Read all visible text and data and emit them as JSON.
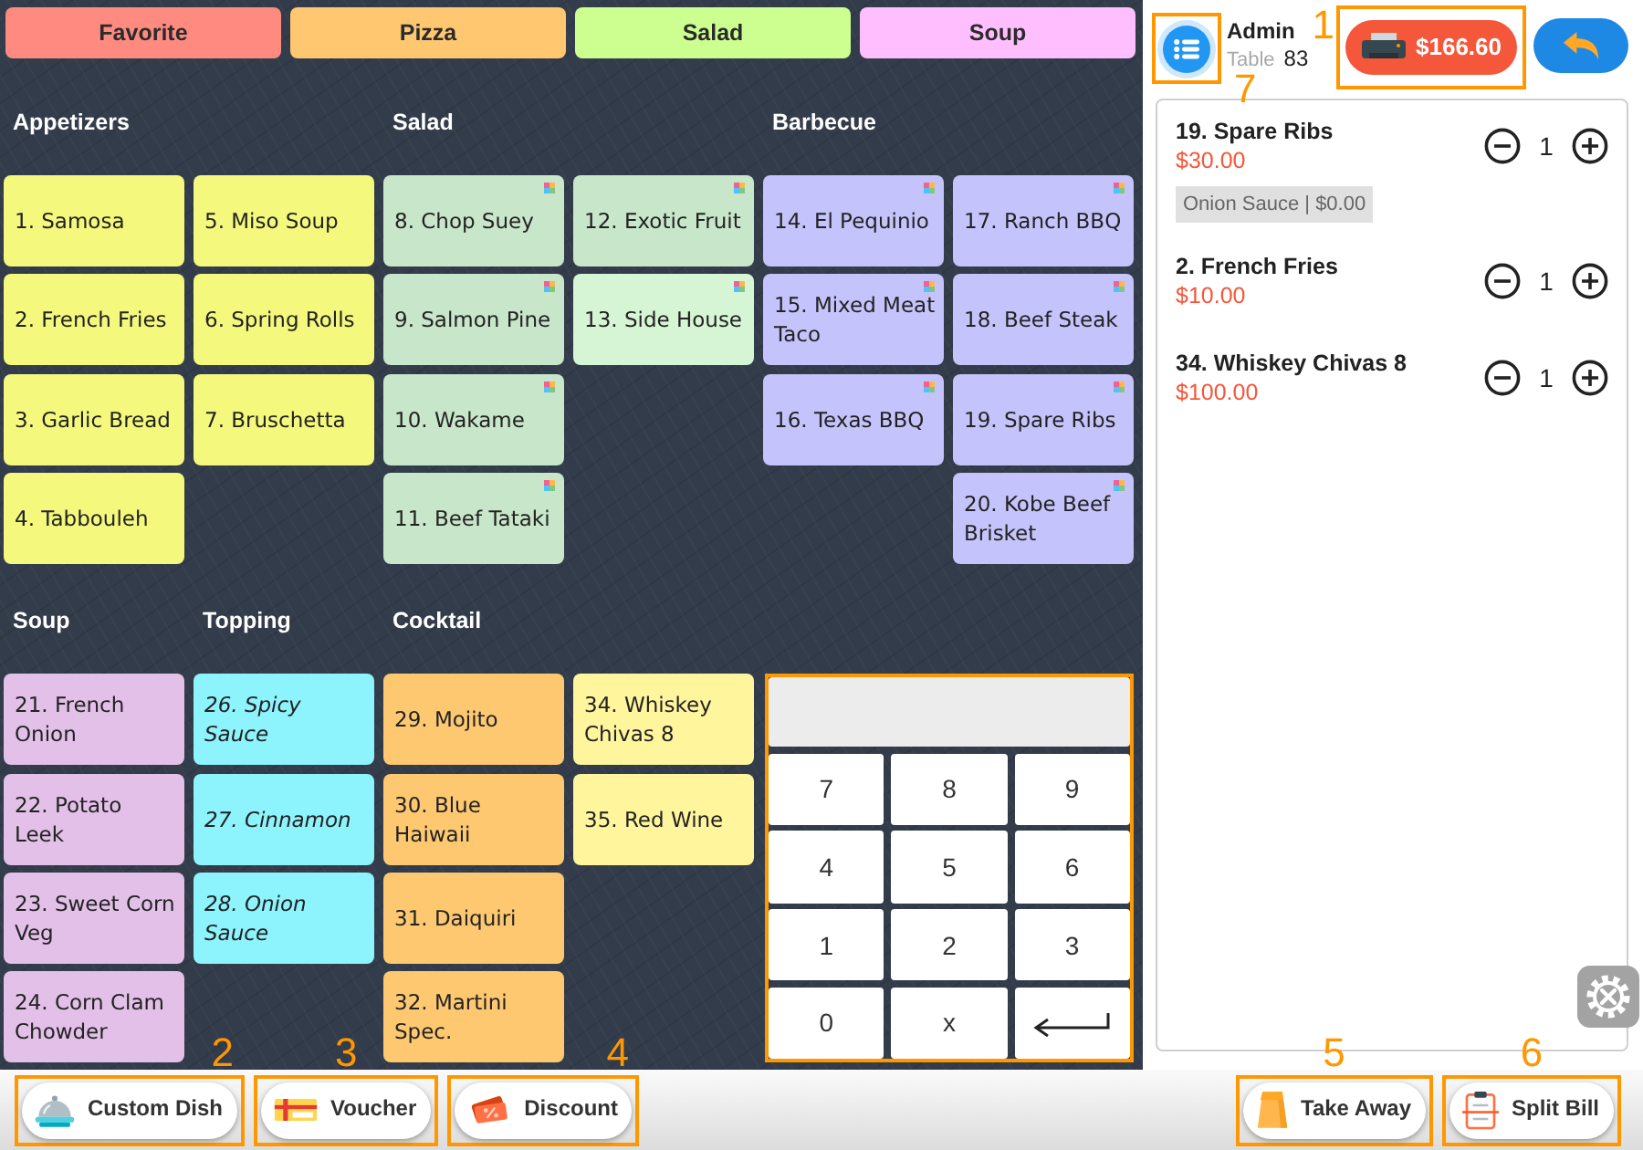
{
  "categories": [
    {
      "label": "Favorite",
      "color": "#ff8a80"
    },
    {
      "label": "Pizza",
      "color": "#ffc870"
    },
    {
      "label": "Salad",
      "color": "#ccff90"
    },
    {
      "label": "Soup",
      "color": "#ffbfff"
    }
  ],
  "menu_rows": [
    {
      "sections": [
        {
          "title": "Appetizers",
          "kind": "dish",
          "columns": [
            [
              {
                "name": "1. Samosa",
                "color": "#f4f87c",
                "modifier_icon": false
              },
              {
                "name": "2. French Fries",
                "color": "#f4f87c",
                "modifier_icon": false
              },
              {
                "name": "3. Garlic Bread",
                "color": "#f4f87c",
                "modifier_icon": false
              },
              {
                "name": "4. Tabbouleh",
                "color": "#f4f87c",
                "modifier_icon": false
              }
            ],
            [
              {
                "name": "5. Miso Soup",
                "color": "#f4f87c",
                "modifier_icon": false
              },
              {
                "name": "6. Spring Rolls",
                "color": "#f4f87c",
                "modifier_icon": false
              },
              {
                "name": "7. Bruschetta",
                "color": "#f4f87c",
                "modifier_icon": false
              }
            ]
          ]
        },
        {
          "title": "Salad",
          "kind": "dish",
          "columns": [
            [
              {
                "name": "8. Chop Suey",
                "color": "#c8e6c9",
                "modifier_icon": true
              },
              {
                "name": "9. Salmon Pine",
                "color": "#c8e6c9",
                "modifier_icon": true
              },
              {
                "name": "10. Wakame",
                "color": "#c8e6c9",
                "modifier_icon": true
              },
              {
                "name": "11. Beef Tataki",
                "color": "#c8e6c9",
                "modifier_icon": true
              }
            ],
            [
              {
                "name": "12. Exotic Fruit",
                "color": "#c8e6c9",
                "modifier_icon": true
              },
              {
                "name": "13. Side House",
                "color": "#d6f5d4",
                "modifier_icon": true
              }
            ]
          ]
        },
        {
          "title": "Barbecue",
          "kind": "dish",
          "columns": [
            [
              {
                "name": "14. El Pequinio",
                "color": "#c5c3fb",
                "modifier_icon": true
              },
              {
                "name": "15. Mixed Meat Taco",
                "color": "#c5c3fb",
                "modifier_icon": true
              },
              {
                "name": "16. Texas BBQ",
                "color": "#c5c3fb",
                "modifier_icon": true
              }
            ],
            [
              {
                "name": "17. Ranch BBQ",
                "color": "#c5c3fb",
                "modifier_icon": true
              },
              {
                "name": "18. Beef Steak",
                "color": "#c5c3fb",
                "modifier_icon": true
              },
              {
                "name": "19. Spare Ribs",
                "color": "#c5c3fb",
                "modifier_icon": true
              },
              {
                "name": "20. Kobe Beef Brisket",
                "color": "#c5c3fb",
                "modifier_icon": true
              }
            ]
          ]
        }
      ]
    },
    {
      "sections": [
        {
          "title": "Soup",
          "kind": "dish",
          "columns": [
            [
              {
                "name": "21. French Onion",
                "color": "#e2c0e8",
                "modifier_icon": false
              },
              {
                "name": "22. Potato Leek",
                "color": "#e2c0e8",
                "modifier_icon": false
              },
              {
                "name": "23. Sweet Corn Veg",
                "color": "#e2c0e8",
                "modifier_icon": false
              },
              {
                "name": "24. Corn Clam Chowder",
                "color": "#e2c0e8",
                "modifier_icon": false
              }
            ]
          ]
        },
        {
          "title": "Topping",
          "kind": "topping",
          "columns": [
            [
              {
                "name": "26. Spicy Sauce",
                "color": "#8df3fc",
                "modifier_icon": false
              },
              {
                "name": "27. Cinnamon",
                "color": "#8df3fc",
                "modifier_icon": false
              },
              {
                "name": "28. Onion Sauce",
                "color": "#8df3fc",
                "modifier_icon": false
              }
            ]
          ]
        },
        {
          "title": "Cocktail",
          "kind": "dish",
          "columns": [
            [
              {
                "name": "29. Mojito",
                "color": "#fec870",
                "modifier_icon": false
              },
              {
                "name": "30. Blue Haiwaii",
                "color": "#fec870",
                "modifier_icon": false
              },
              {
                "name": "31. Daiquiri",
                "color": "#fec870",
                "modifier_icon": false
              },
              {
                "name": "32. Martini Spec.",
                "color": "#fec870",
                "modifier_icon": false
              }
            ],
            [
              {
                "name": "34. Whiskey Chivas 8",
                "color": "#fff59d",
                "modifier_icon": false
              },
              {
                "name": "35. Red Wine",
                "color": "#fff59d",
                "modifier_icon": false
              }
            ]
          ]
        }
      ]
    }
  ],
  "numpad": {
    "highlighted": true,
    "keys": [
      {
        "kind": "char",
        "label": "7"
      },
      {
        "kind": "char",
        "label": "8"
      },
      {
        "kind": "char",
        "label": "9"
      },
      {
        "kind": "char",
        "label": "4"
      },
      {
        "kind": "char",
        "label": "5"
      },
      {
        "kind": "char",
        "label": "6"
      },
      {
        "kind": "char",
        "label": "1"
      },
      {
        "kind": "char",
        "label": "2"
      },
      {
        "kind": "char",
        "label": "3"
      },
      {
        "kind": "char",
        "label": "0"
      },
      {
        "kind": "char",
        "label": "x"
      },
      {
        "kind": "enter"
      }
    ]
  },
  "header": {
    "menu_button": {
      "callout": "7"
    },
    "user": "Admin",
    "table_label": "Table",
    "table_number": "83",
    "total_button": {
      "label": "$166.60",
      "callout": "1"
    }
  },
  "order_items": [
    {
      "name": "19. Spare Ribs",
      "price": "$30.00",
      "quantity": "1",
      "modifiers": [
        "Onion Sauce | $0.00"
      ]
    },
    {
      "name": "2. French Fries",
      "price": "$10.00",
      "quantity": "1"
    },
    {
      "name": "34. Whiskey Chivas 8",
      "price": "$100.00",
      "quantity": "1"
    }
  ],
  "bottom_bar": {
    "left": [
      {
        "kind": "custom_dish",
        "label": "Custom Dish",
        "callout": "2"
      },
      {
        "kind": "voucher",
        "label": "Voucher",
        "callout": "3"
      },
      {
        "kind": "discount",
        "label": "Discount",
        "callout": "4"
      }
    ],
    "right": [
      {
        "kind": "take_away",
        "label": "Take Away",
        "callout": "5"
      },
      {
        "kind": "split_bill",
        "label": "Split Bill",
        "callout": "6"
      }
    ]
  }
}
